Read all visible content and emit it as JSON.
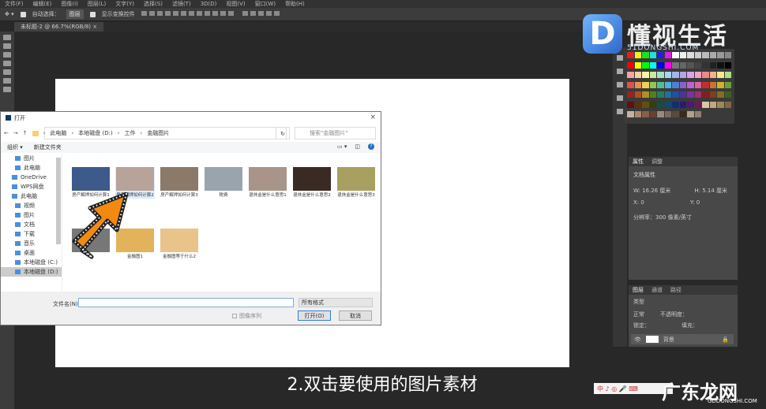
{
  "menu": [
    "文件(F)",
    "编辑(E)",
    "图像(I)",
    "图层(L)",
    "文字(Y)",
    "选择(S)",
    "滤镜(T)",
    "3D(D)",
    "视图(V)",
    "窗口(W)",
    "帮助(H)"
  ],
  "options": {
    "auto_select": "自动选择：",
    "auto_select_value": "图层",
    "show_transform": "显示变换控件"
  },
  "doc_tab": "未标题-2 @ 66.7%(RGB/8)",
  "dialog": {
    "title": "打开",
    "close": "×",
    "path": [
      "此电脑",
      "本地磁盘 (D:)",
      "工作",
      "金融图片"
    ],
    "search_placeholder": "搜索\"金融图片\"",
    "organize": "组织 ▾",
    "new_folder": "新建文件夹",
    "nav": [
      {
        "label": "图片",
        "sub": true
      },
      {
        "label": "此电脑",
        "sub": true
      },
      {
        "label": "OneDrive"
      },
      {
        "label": "WPS网盘"
      },
      {
        "label": "此电脑"
      },
      {
        "label": "视频",
        "sub": true
      },
      {
        "label": "图片",
        "sub": true
      },
      {
        "label": "文档",
        "sub": true
      },
      {
        "label": "下载",
        "sub": true
      },
      {
        "label": "音乐",
        "sub": true
      },
      {
        "label": "桌面",
        "sub": true
      },
      {
        "label": "本地磁盘 (C:)",
        "sub": true
      },
      {
        "label": "本地磁盘 (D:)",
        "sub": true,
        "selected": true
      }
    ],
    "files": [
      {
        "name": "房产解押如何计算1",
        "color": "#3c5a8a"
      },
      {
        "name": "房产解押如何计算2",
        "color": "#b7a39a",
        "selected": true
      },
      {
        "name": "房产解押如何计算3",
        "color": "#8b7a6a"
      },
      {
        "name": "税费",
        "color": "#9aa4ad"
      },
      {
        "name": "退休金是什么意思1",
        "color": "#a89488"
      },
      {
        "name": "退休金是什么意思2",
        "color": "#3a2a24"
      },
      {
        "name": "退休金是什么意思3",
        "color": "#a8a060"
      },
      {
        "name": "",
        "color": "#777"
      },
      {
        "name": "金融图1",
        "color": "#e2b35a"
      },
      {
        "name": "金融图等于什么2",
        "color": "#e8c48a"
      }
    ],
    "filename_label": "文件名(N):",
    "filename_value": "",
    "filetype": "所有格式",
    "preview_label": "图像序列",
    "open": "打开(O)",
    "cancel": "取消"
  },
  "properties": {
    "tabs": [
      "属性",
      "调整"
    ],
    "type": "文档属性",
    "w": "W: 16.26 厘米",
    "h": "H: 5.14 厘米",
    "x": "X: 0",
    "y": "Y: 0",
    "resolution": "分辨率：300 像素/英寸"
  },
  "layers": {
    "tabs": [
      "图层",
      "通道",
      "路径"
    ],
    "kind": "类型",
    "mode": "正常",
    "opacity": "不透明度：",
    "lock": "锁定：",
    "fill": "填充：",
    "layer_name": "背景"
  },
  "swatch_colors": [
    "#e02020",
    "#f0f020",
    "#20e020",
    "#20e0e0",
    "#2020e0",
    "#e020e0",
    "#fff",
    "#eee",
    "#ddd",
    "#ccc",
    "#bbb",
    "#aaa",
    "#999",
    "#888",
    "#ff0000",
    "#ffff00",
    "#00ff00",
    "#00ffff",
    "#0000ff",
    "#ff00ff",
    "#777",
    "#666",
    "#555",
    "#444",
    "#333",
    "#222",
    "#111",
    "#000",
    "#f7a3a3",
    "#f7d0a3",
    "#fbf2a3",
    "#c7eaa3",
    "#a3e3c7",
    "#a3d8f2",
    "#a3b6ea",
    "#b8a3ea",
    "#dca3ea",
    "#f0a3cf",
    "#ea8a8a",
    "#f2b28a",
    "#f7e88a",
    "#b0dd8a",
    "#e05050",
    "#e89050",
    "#f0d050",
    "#90c850",
    "#50c090",
    "#50b0e0",
    "#5080d0",
    "#8a60d0",
    "#c060d0",
    "#e060a0",
    "#c03030",
    "#d07030",
    "#d0b030",
    "#70a030",
    "#a02020",
    "#b05020",
    "#b09020",
    "#508020",
    "#208060",
    "#2070a0",
    "#2050a0",
    "#5030a0",
    "#8030a0",
    "#a03070",
    "#802020",
    "#804020",
    "#807020",
    "#406020",
    "#601010",
    "#603010",
    "#605010",
    "#304010",
    "#105040",
    "#104870",
    "#103070",
    "#301870",
    "#501870",
    "#701850",
    "#d8c8a8",
    "#c0a880",
    "#a08858",
    "#806840",
    "#c8b0a0",
    "#a88870",
    "#886048",
    "#684030",
    "#9a8a7a",
    "#7a6a5a",
    "#5a4a3a",
    "#3a2a1a",
    "#b0a090",
    "#908070"
  ],
  "watermark": {
    "brand": "懂视生活",
    "mark": "D",
    "sub": "51DONGSHI.COM"
  },
  "subtitle": "2.双击要使用的图片素材",
  "ime": "中 ♪ ◎ 🎤 ⌨",
  "watermark2": {
    "brand": "广东龙网",
    "sub": "GDDONGSHI.COM"
  }
}
